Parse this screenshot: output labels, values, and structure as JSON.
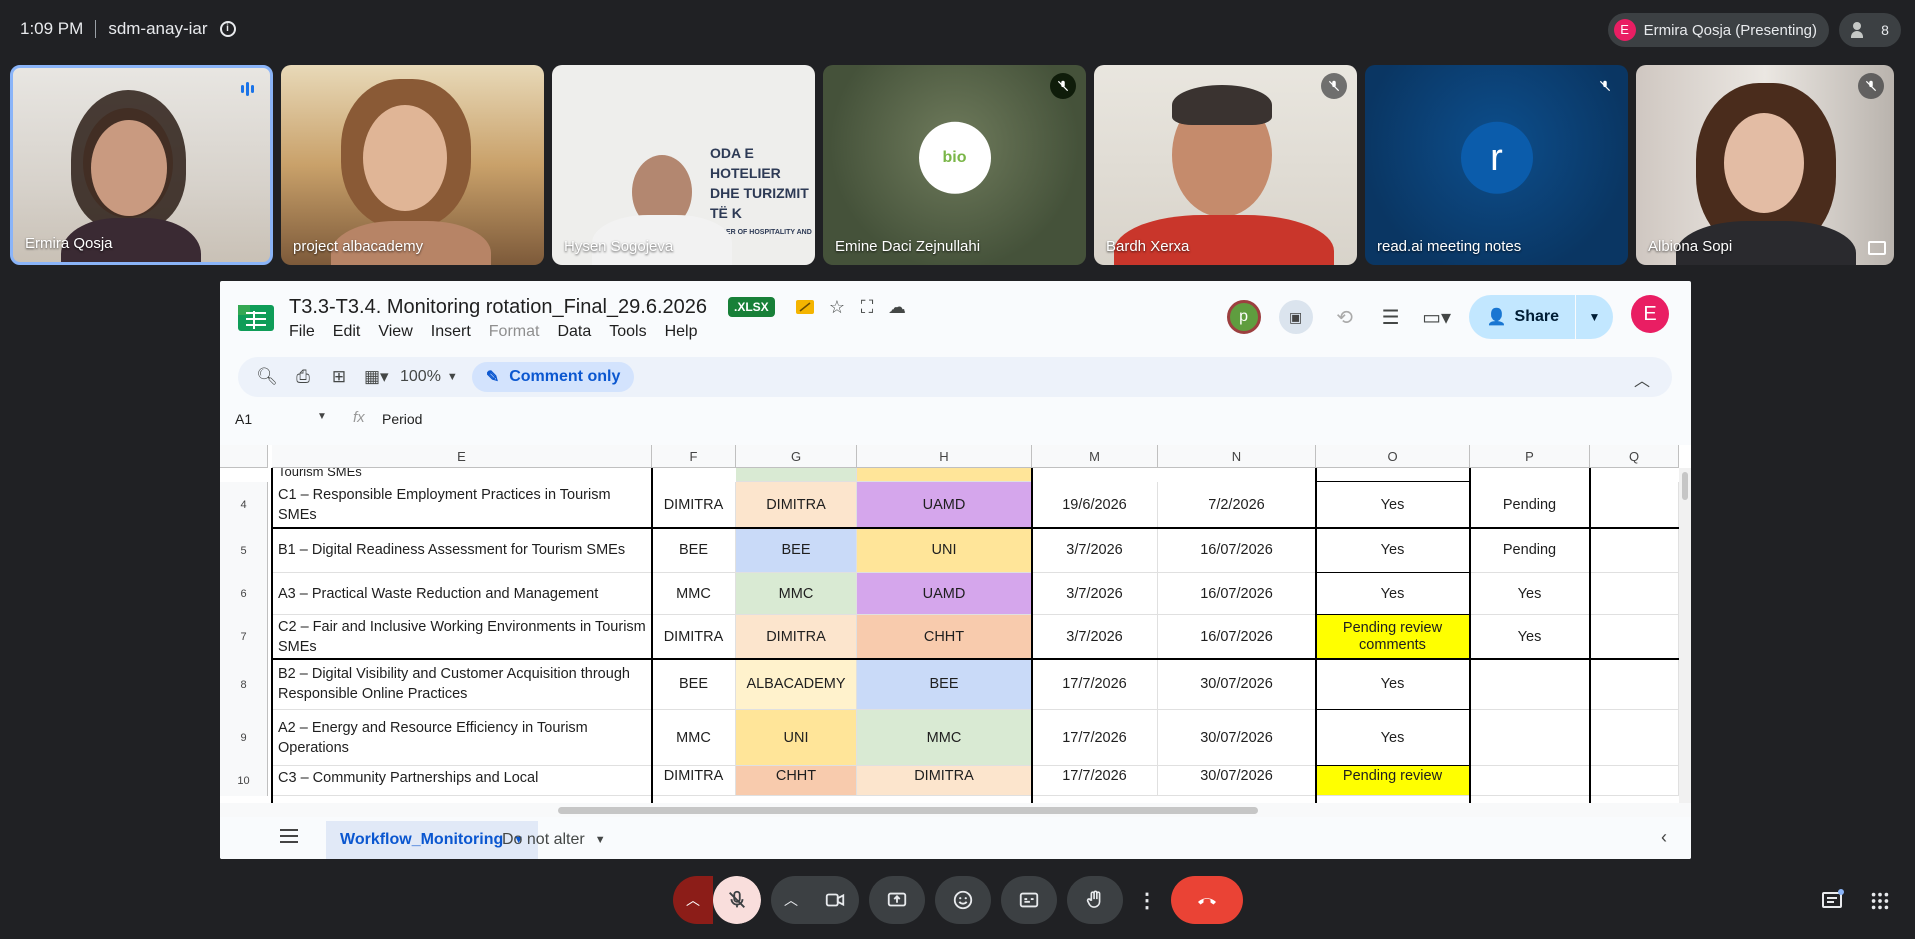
{
  "meeting": {
    "time": "1:09 PM",
    "code": "sdm-anay-iar",
    "presenter_initial": "E",
    "presenter_chip": "Ermira Qosja (Presenting)",
    "participant_count": "8"
  },
  "tiles": [
    {
      "name": "Ermira Qosja",
      "state": "speaking"
    },
    {
      "name": "project albacademy",
      "state": "video"
    },
    {
      "name": "Hysen Sogojeva",
      "state": "video",
      "background_text": [
        "ODA E HOTELIER",
        "DHE TURIZMIT TË K",
        "AMBER OF HOSPITALITY AND TO"
      ]
    },
    {
      "name": "Emine Daci Zejnullahi",
      "state": "muted",
      "avatar_text": "bio"
    },
    {
      "name": "Bardh Xerxa",
      "state": "muted"
    },
    {
      "name": "read.ai meeting notes",
      "state": "muted",
      "avatar_letter": "r"
    },
    {
      "name": "Albiona Sopi",
      "state": "muted"
    }
  ],
  "sheet": {
    "title": "T3.3-T3.4. Monitoring rotation_Final_29.6.2026",
    "file_badge": ".XLSX",
    "menu": [
      "File",
      "Edit",
      "View",
      "Insert",
      "Format",
      "Data",
      "Tools",
      "Help"
    ],
    "collaborator_initial": "p",
    "share_label": "Share",
    "user_initial": "E",
    "zoom": "100%",
    "mode_label": "Comment only",
    "cell_ref": "A1",
    "formula_value": "Period",
    "columns": [
      "E",
      "F",
      "G",
      "H",
      "M",
      "N",
      "O",
      "P",
      "Q"
    ],
    "top_partial_text": "Tourism SMEs",
    "rows": [
      {
        "num": "4",
        "e": "C1 – Responsible Employment Practices in Tourism SMEs",
        "f": "DIMITRA",
        "g": "DIMITRA",
        "h": "UAMD",
        "m": "19/6/2026",
        "n": "7/2/2026",
        "o": "Yes",
        "p": "Pending",
        "q": ""
      },
      {
        "num": "5",
        "e": "B1 – Digital Readiness Assessment for Tourism SMEs",
        "f": "BEE",
        "g": "BEE",
        "h": "UNI",
        "m": "3/7/2026",
        "n": "16/07/2026",
        "o": "Yes",
        "p": "Pending",
        "q": ""
      },
      {
        "num": "6",
        "e": "A3 – Practical Waste Reduction and Management",
        "f": "MMC",
        "g": "MMC",
        "h": "UAMD",
        "m": "3/7/2026",
        "n": "16/07/2026",
        "o": "Yes",
        "p": "Yes",
        "q": ""
      },
      {
        "num": "7",
        "e": "C2 – Fair and Inclusive Working Environments in Tourism SMEs",
        "f": "DIMITRA",
        "g": "DIMITRA",
        "h": "CHHT",
        "m": "3/7/2026",
        "n": "16/07/2026",
        "o": "Pending review comments",
        "p": "Yes",
        "q": ""
      },
      {
        "num": "8",
        "e": "B2 – Digital Visibility and Customer Acquisition through Responsible Online Practices",
        "f": "BEE",
        "g": "ALBACADEMY",
        "h": "BEE",
        "m": "17/7/2026",
        "n": "30/07/2026",
        "o": "Yes",
        "p": "",
        "q": ""
      },
      {
        "num": "9",
        "e": "A2 – Energy and Resource Efficiency in Tourism Operations",
        "f": "MMC",
        "g": "UNI",
        "h": "MMC",
        "m": "17/7/2026",
        "n": "30/07/2026",
        "o": "Yes",
        "p": "",
        "q": ""
      },
      {
        "num": "10",
        "e": "C3 – Community Partnerships and Local",
        "f": "DIMITRA",
        "g": "CHHT",
        "h": "DIMITRA",
        "m": "17/7/2026",
        "n": "30/07/2026",
        "o": "Pending review",
        "p": "",
        "q": ""
      }
    ],
    "tabs": [
      "Workflow_Monitoring",
      "Do not alter"
    ]
  },
  "colors": {
    "partner_fills": {
      "DIMITRA": "#fce5cd",
      "BEE": "#c9daf8",
      "MMC": "#d9ead3",
      "UNI": "#ffe599",
      "UAMD": "#d5a6ec",
      "CHHT": "#f8cbad",
      "ALBACADEMY": "#fff2cc"
    },
    "pending_review": "#ffff00",
    "hangup": "#ea4335",
    "accent": "#0b57d0"
  }
}
